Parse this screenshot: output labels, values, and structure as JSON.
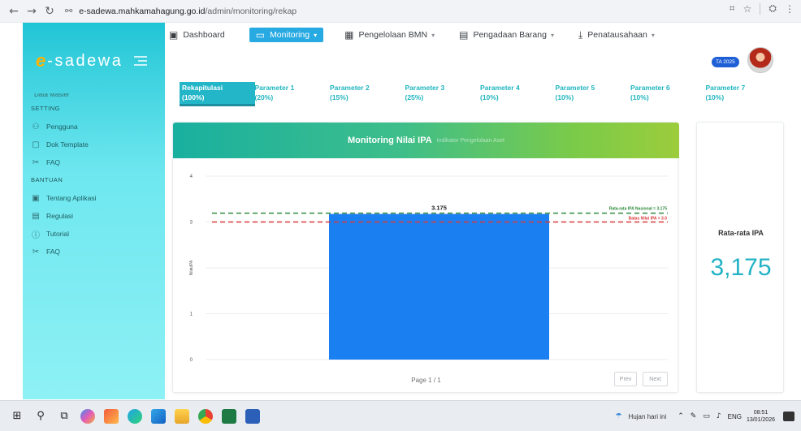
{
  "browser": {
    "domain": "e-sadewa.mahkamahagung.go.id",
    "path": "/admin/monitoring/rekap"
  },
  "brand": {
    "e": "e",
    "rest": "-sadewa"
  },
  "sidebar": {
    "sections": [
      {
        "title": "SETTING",
        "items": [
          {
            "label": "Pengguna",
            "icon": "users-icon"
          },
          {
            "label": "Dok Template",
            "icon": "document-icon"
          },
          {
            "label": "FAQ",
            "icon": "tools-icon"
          }
        ]
      },
      {
        "title": "BANTUAN",
        "items": [
          {
            "label": "Tentang Aplikasi",
            "icon": "info-card-icon"
          },
          {
            "label": "Regulasi",
            "icon": "regulation-icon"
          },
          {
            "label": "Tutorial",
            "icon": "info-circle-icon"
          },
          {
            "label": "FAQ",
            "icon": "tools-icon"
          }
        ]
      }
    ]
  },
  "topnav": {
    "items": [
      {
        "label": "Dashboard",
        "icon": "dashboard-icon",
        "dropdown": false,
        "active": false
      },
      {
        "label": "Monitoring",
        "icon": "monitor-icon",
        "dropdown": true,
        "active": true
      },
      {
        "label": "Pengelolaan BMN",
        "icon": "building-icon",
        "dropdown": true,
        "active": false
      },
      {
        "label": "Pengadaan Barang",
        "icon": "clipboard-icon",
        "dropdown": true,
        "active": false
      },
      {
        "label": "Penatausahaan",
        "icon": "download-icon",
        "dropdown": true,
        "active": false
      }
    ],
    "ta_badge": "TA 2025"
  },
  "param_tabs": [
    {
      "name": "Rekapitulasi",
      "weight": "(100%)",
      "active": true
    },
    {
      "name": "Parameter 1",
      "weight": "(20%)"
    },
    {
      "name": "Parameter 2",
      "weight": "(15%)"
    },
    {
      "name": "Parameter 3",
      "weight": "(25%)"
    },
    {
      "name": "Parameter 4",
      "weight": "(10%)"
    },
    {
      "name": "Parameter 5",
      "weight": "(10%)"
    },
    {
      "name": "Parameter 6",
      "weight": "(10%)"
    },
    {
      "name": "Parameter 7",
      "weight": "(10%)"
    }
  ],
  "chart_card": {
    "title": "Monitoring Nilai IPA",
    "subtitle": "Indikator Pengelolaan Aset",
    "pager": "Page 1 / 1",
    "prev": "Prev",
    "next": "Next"
  },
  "chart_data": {
    "type": "bar",
    "categories": [
      ""
    ],
    "values": [
      3.175
    ],
    "value_labels": [
      "3.175"
    ],
    "ylabel": "Nilai IPA",
    "ylim": [
      0,
      4
    ],
    "yticks": [
      0,
      1,
      2,
      3,
      4
    ],
    "reference_lines": [
      {
        "label": "Rata-rata IPA Nasional = 3.175",
        "value": 3.175,
        "color": "#2e8b3d"
      },
      {
        "label": "Batas Nilai IPA = 3.0",
        "value": 3.0,
        "color": "#d83a3a"
      }
    ],
    "bar_color": "#1a7ff0",
    "grid": true
  },
  "stat": {
    "label": "Rata-rata IPA",
    "value": "3,175"
  },
  "taskbar": {
    "weather": "Hujan hari ini",
    "lang": "ENG",
    "time": "08:51",
    "date": "13/01/2026"
  },
  "colors": {
    "sidebar": "#3ad0de",
    "accent": "#23b6c9",
    "header_start": "#19b09f",
    "header_end": "#9ccc3c"
  }
}
